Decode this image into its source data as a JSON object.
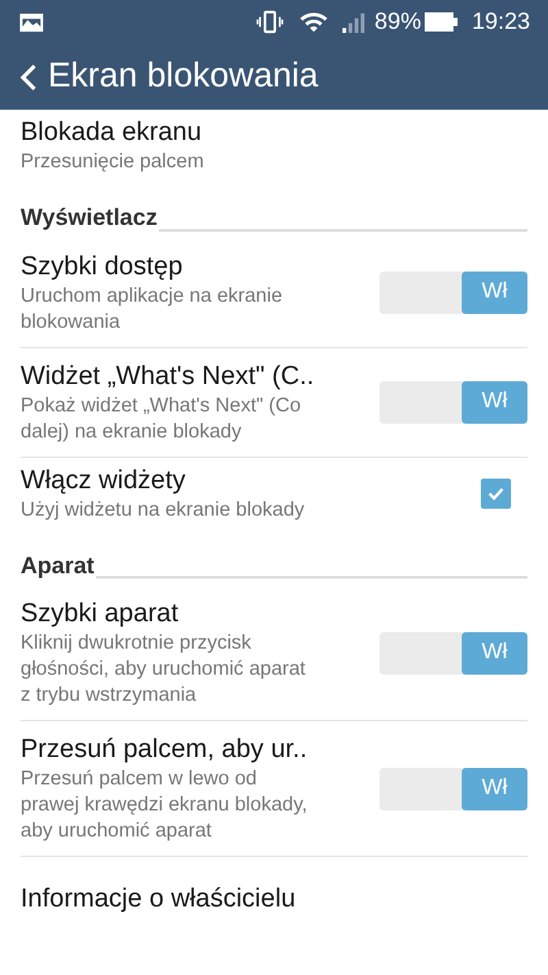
{
  "status_bar": {
    "battery_percent": "89%",
    "time": "19:23"
  },
  "app_bar": {
    "title": "Ekran blokowania"
  },
  "sections": [
    {
      "items": [
        {
          "kind": "plain",
          "title": "Blokada ekranu",
          "summary": "Przesunięcie palcem"
        }
      ]
    },
    {
      "header": "Wyświetlacz",
      "items": [
        {
          "kind": "toggle",
          "title": "Szybki dostęp",
          "summary": "Uruchom aplikacje na ekranie blokowania",
          "on": true,
          "on_label": "Wł"
        },
        {
          "kind": "toggle",
          "title": "Widżet „What's Next\" (C..",
          "summary": "Pokaż widżet „What's Next\" (Co dalej) na ekranie blokady",
          "on": true,
          "on_label": "Wł"
        },
        {
          "kind": "checkbox",
          "title": "Włącz widżety",
          "summary": "Użyj widżetu na ekranie blokady",
          "checked": true
        }
      ]
    },
    {
      "header": "Aparat",
      "items": [
        {
          "kind": "toggle",
          "title": "Szybki aparat",
          "summary": "Kliknij dwukrotnie przycisk głośności, aby uruchomić aparat z trybu wstrzymania",
          "on": true,
          "on_label": "Wł"
        },
        {
          "kind": "toggle",
          "title": "Przesuń palcem, aby ur..",
          "summary": "Przesuń palcem w lewo od prawej krawędzi ekranu blokady, aby uruchomić aparat",
          "on": true,
          "on_label": "Wł"
        },
        {
          "kind": "plain",
          "title": "Informacje o właścicielu"
        }
      ]
    }
  ]
}
